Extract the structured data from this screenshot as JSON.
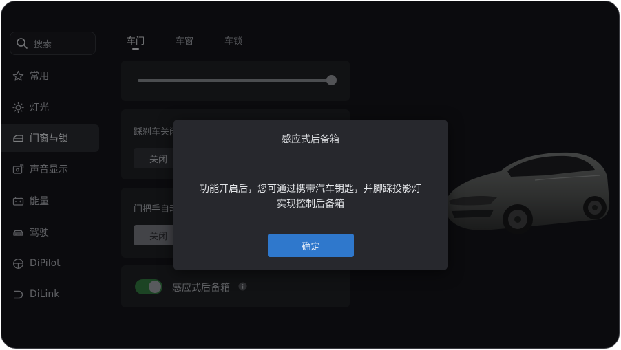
{
  "search": {
    "placeholder": "搜索",
    "icon": "search-icon"
  },
  "sidebar": {
    "items": [
      {
        "label": "常用",
        "icon": "star-icon",
        "active": false
      },
      {
        "label": "灯光",
        "icon": "sun-icon",
        "active": false
      },
      {
        "label": "门窗与锁",
        "icon": "car-door-icon",
        "active": true
      },
      {
        "label": "声音显示",
        "icon": "display-sound-icon",
        "active": false
      },
      {
        "label": "能量",
        "icon": "battery-icon",
        "active": false
      },
      {
        "label": "驾驶",
        "icon": "car-icon",
        "active": false
      },
      {
        "label": "DiPilot",
        "icon": "steering-wheel-icon",
        "active": false
      },
      {
        "label": "DiLink",
        "icon": "dilink-icon",
        "active": false
      }
    ]
  },
  "tabs": [
    {
      "label": "车门",
      "active": true
    },
    {
      "label": "车窗",
      "active": false
    },
    {
      "label": "车锁",
      "active": false
    }
  ],
  "settings": {
    "slider": {
      "value_fraction": 1.0
    },
    "brake_close": {
      "title": "踩刹车关闭",
      "option_off": "关闭"
    },
    "handle_auto": {
      "title": "门把手自动",
      "option_off": "关闭"
    },
    "tailgate": {
      "label": "感应式后备箱",
      "enabled": true
    }
  },
  "modal": {
    "title": "感应式后备箱",
    "body_line1": "功能开启后，您可通过携带汽车钥匙，并脚踩投影灯",
    "body_line2": "实现控制后备箱",
    "confirm_label": "确定"
  },
  "colors": {
    "background": "#121317",
    "card": "#1c1d21",
    "modal": "#27282d",
    "accent_blue": "#2f78cc",
    "toggle_on": "#2e6f3a"
  }
}
